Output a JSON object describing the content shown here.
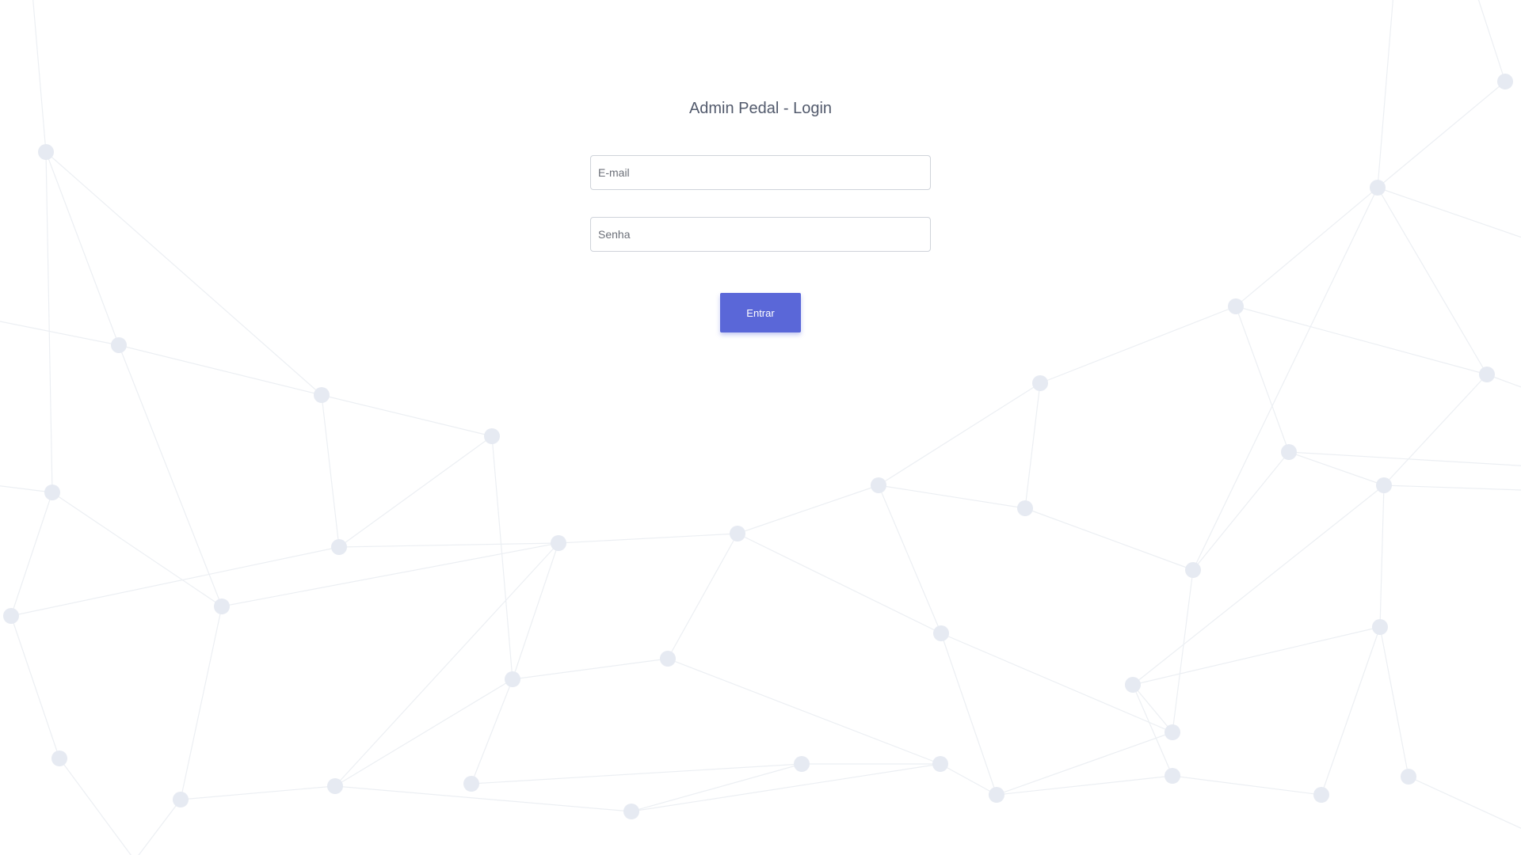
{
  "login": {
    "title": "Admin Pedal - Login",
    "email_placeholder": "E-mail",
    "email_value": "",
    "password_placeholder": "Senha",
    "password_value": "",
    "submit_label": "Entrar"
  },
  "colors": {
    "accent": "#5a67d8",
    "background": "#ffffff",
    "network_node": "#e8ecf3",
    "network_line": "#eef0f4"
  }
}
